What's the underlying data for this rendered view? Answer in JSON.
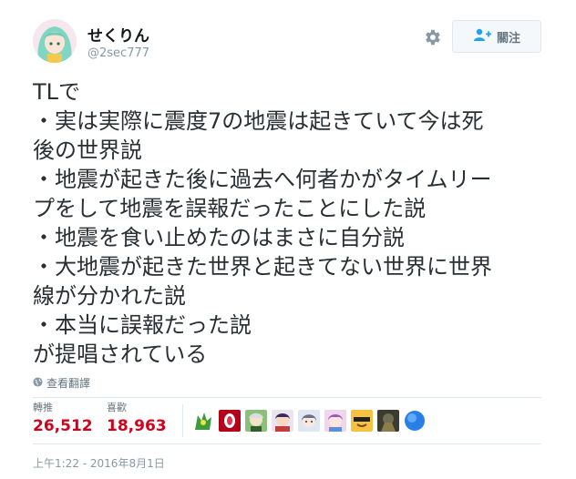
{
  "user": {
    "display_name": "せくりん",
    "handle": "@2sec777"
  },
  "follow_button": {
    "label": "關注",
    "icon": "add-user-icon"
  },
  "settings_icon": "gear-icon",
  "tweet": {
    "lines": [
      "TLで",
      "・実は実際に震度7の地震は起きていて今は死",
      "後の世界説",
      "・地震が起きた後に過去へ何者かがタイムリー",
      "プをして地震を誤報だったことにした説",
      "・地震を食い止めたのはまさに自分説",
      "・大地震が起きた世界と起きてない世界に世界",
      "線が分かれた説",
      "・本当に誤報だった説",
      "が提唱されている"
    ]
  },
  "translate_link": {
    "label": "查看翻譯",
    "icon": "globe-icon"
  },
  "stats": {
    "retweets": {
      "label": "轉推",
      "value": "26,512"
    },
    "likes": {
      "label": "喜歡",
      "value": "18,963"
    }
  },
  "liker_avatars": [
    "liker-1",
    "liker-2",
    "liker-3",
    "liker-4",
    "liker-5",
    "liker-6",
    "liker-7",
    "liker-8",
    "liker-9"
  ],
  "timestamp": "上午1:22 - 2016年8月1日",
  "colors": {
    "stat_value": "#d0021b",
    "muted": "#8899a6",
    "text": "#292f33"
  }
}
